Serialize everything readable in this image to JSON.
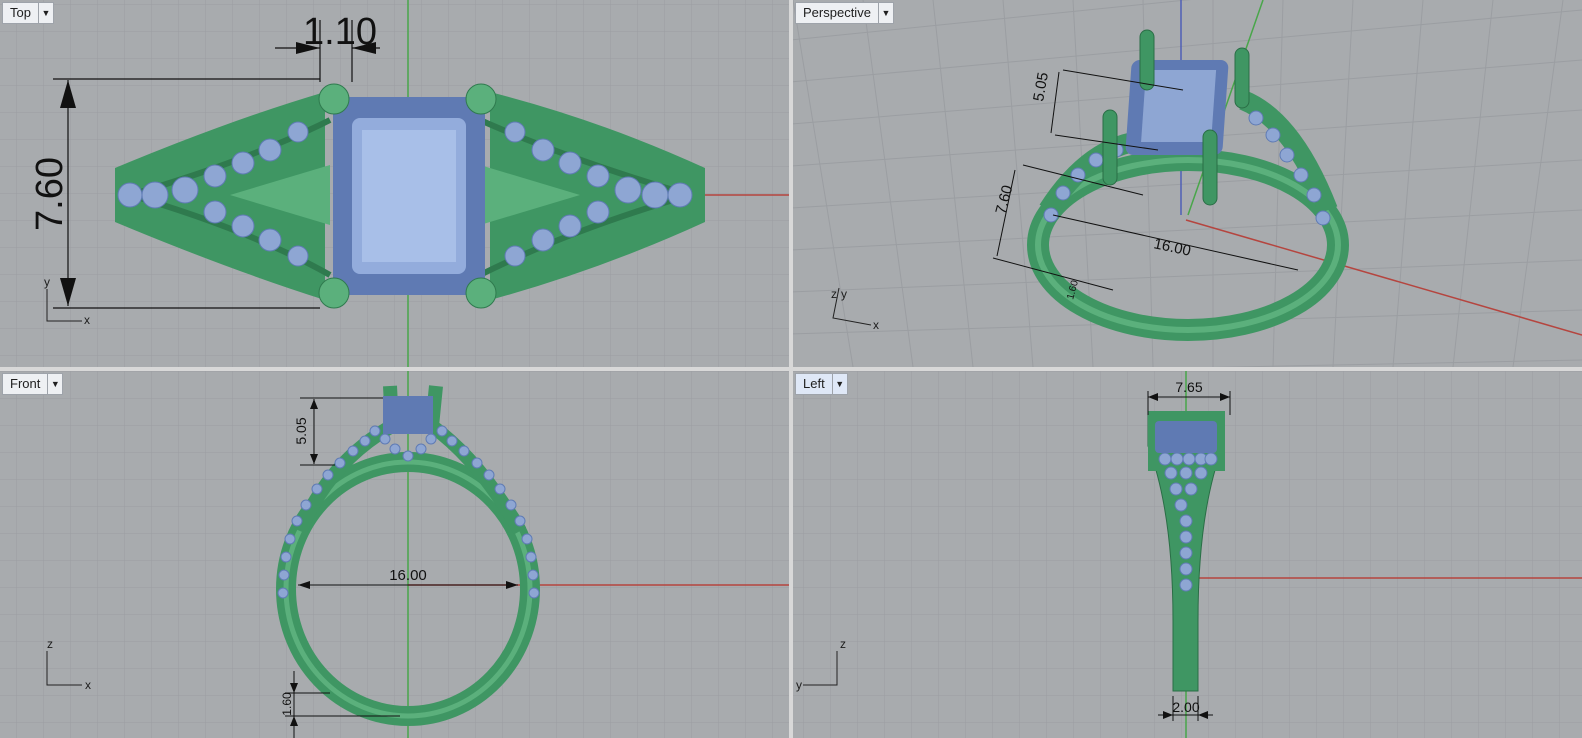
{
  "viewports": {
    "top": {
      "label": "Top",
      "dim_width": "1.10",
      "dim_height": "7.60",
      "axis_y": "y",
      "axis_x": "x"
    },
    "perspective": {
      "label": "Perspective",
      "dim_prong": "5.05",
      "dim_height": "7.60",
      "dim_diameter": "16.00",
      "dim_shank": "1.60",
      "axis_z": "z",
      "axis_y": "y",
      "axis_x": "x"
    },
    "front": {
      "label": "Front",
      "dim_prong": "5.05",
      "dim_diameter": "16.00",
      "dim_shank": "1.60",
      "axis_z": "z",
      "axis_x": "x"
    },
    "left": {
      "label": "Left",
      "dim_width": "7.65",
      "dim_shank": "2.00",
      "axis_z": "z",
      "axis_y": "y"
    }
  },
  "icons": {
    "dropdown": "chevron-down-icon"
  },
  "colors": {
    "viewport_bg": "#a8abae",
    "grid": "#9b9ea2",
    "metal": "#3f9663",
    "gem": "#7e99cd",
    "x_axis": "#b5453f",
    "y_axis": "#49a64a"
  }
}
